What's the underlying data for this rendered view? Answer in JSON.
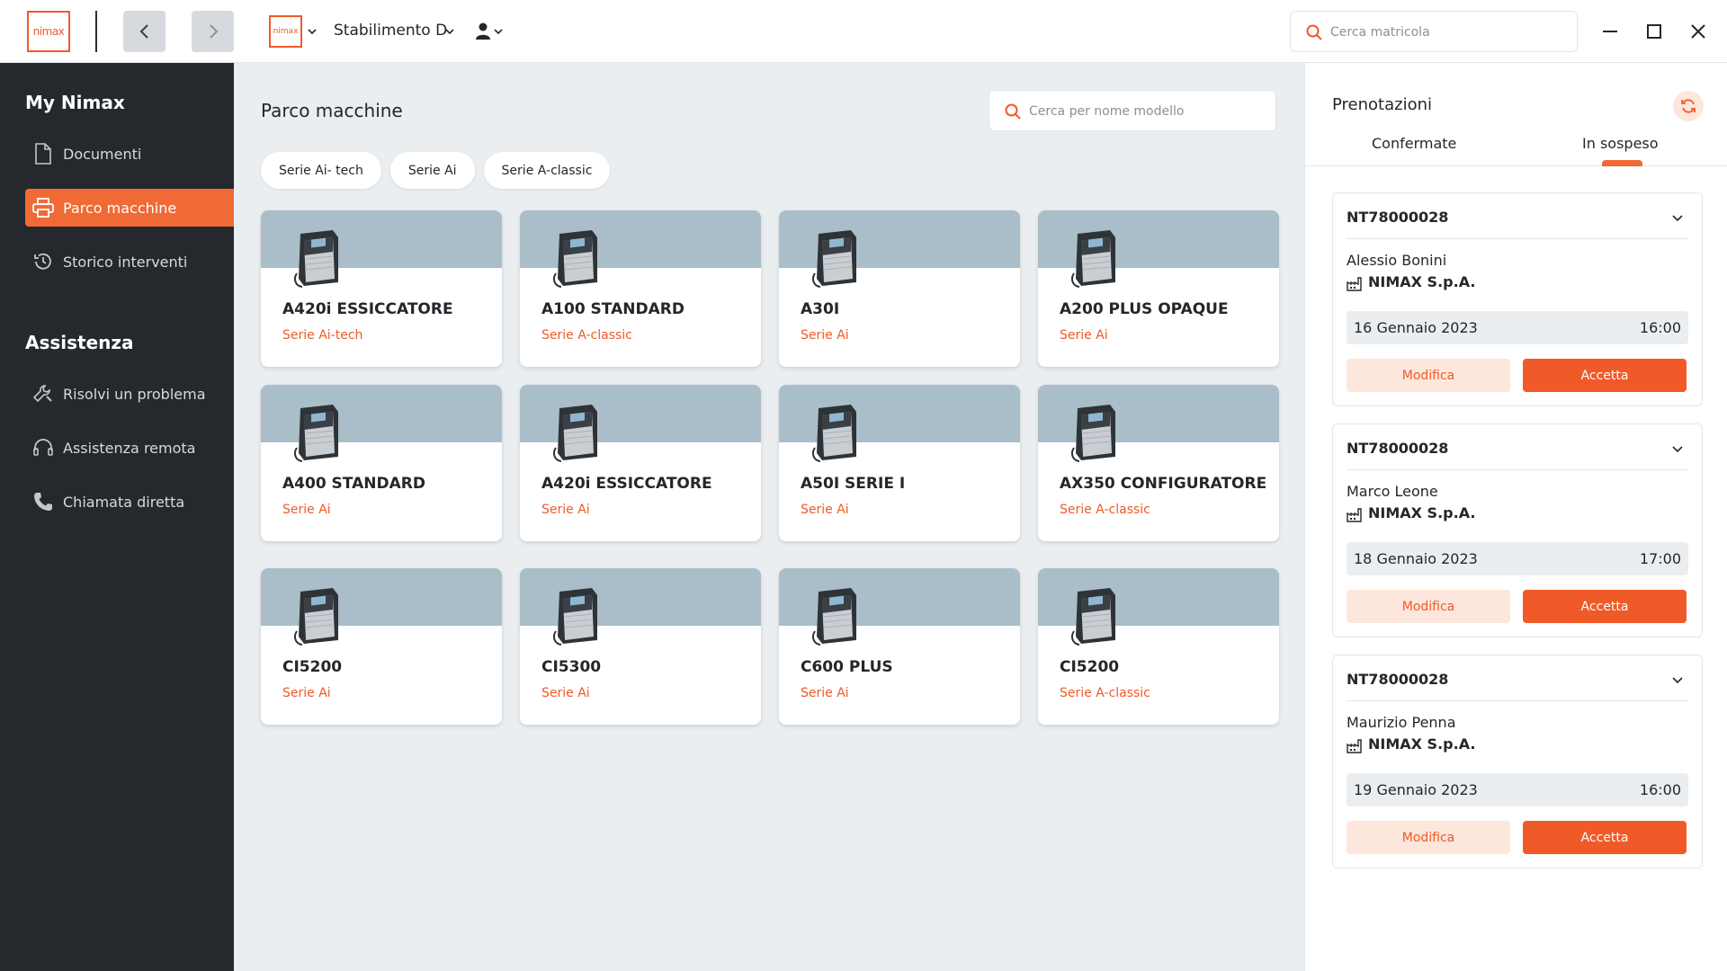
{
  "app": {
    "logo_text": "nimax"
  },
  "topbar": {
    "plant_logo_text": "nimax",
    "plant_name": "Stabilimento D",
    "search_placeholder": "Cerca matricola"
  },
  "sidebar": {
    "section1": "My Nimax",
    "items1": [
      {
        "label": "Documenti",
        "icon": "document-icon"
      },
      {
        "label": "Parco macchine",
        "icon": "printer-icon",
        "active": true
      },
      {
        "label": "Storico interventi",
        "icon": "history-icon"
      }
    ],
    "section2": "Assistenza",
    "items2": [
      {
        "label": "Risolvi un problema",
        "icon": "wrench-icon"
      },
      {
        "label": "Assistenza remota",
        "icon": "headset-icon"
      },
      {
        "label": "Chiamata diretta",
        "icon": "phone-icon"
      }
    ]
  },
  "main": {
    "title": "Parco macchine",
    "search_placeholder": "Cerca per nome modello",
    "filters": [
      "Serie Ai- tech",
      "Serie Ai",
      "Serie A-classic"
    ],
    "machines": [
      {
        "name": "A420i ESSICCATORE",
        "series": "Serie Ai-tech"
      },
      {
        "name": "A100 STANDARD",
        "series": "Serie A-classic"
      },
      {
        "name": "A30I",
        "series": "Serie Ai"
      },
      {
        "name": "A200 PLUS OPAQUE",
        "series": "Serie Ai"
      },
      {
        "name": "A400 STANDARD",
        "series": "Serie Ai"
      },
      {
        "name": "A420i ESSICCATORE",
        "series": "Serie Ai"
      },
      {
        "name": "A50I SERIE I",
        "series": "Serie Ai"
      },
      {
        "name": "AX350 CONFIGURATORE",
        "series": "Serie A-classic"
      },
      {
        "name": "CI5200",
        "series": "Serie Ai"
      },
      {
        "name": "CI5300",
        "series": "Serie Ai"
      },
      {
        "name": "C600 PLUS",
        "series": "Serie Ai"
      },
      {
        "name": "CI5200",
        "series": "Serie A-classic"
      }
    ]
  },
  "bookings": {
    "title": "Prenotazioni",
    "tabs": [
      "Confermate",
      "In sospeso"
    ],
    "active_tab": "In sospeso",
    "modify_label": "Modifica",
    "accept_label": "Accetta",
    "items": [
      {
        "code": "NT78000028",
        "person": "Alessio Bonini",
        "company": "NIMAX S.p.A.",
        "date": "16 Gennaio 2023",
        "time": "16:00"
      },
      {
        "code": "NT78000028",
        "person": "Marco Leone",
        "company": "NIMAX S.p.A.",
        "date": "18 Gennaio 2023",
        "time": "17:00"
      },
      {
        "code": "NT78000028",
        "person": "Maurizio Penna",
        "company": "NIMAX S.p.A.",
        "date": "19 Gennaio 2023",
        "time": "16:00"
      }
    ]
  },
  "colors": {
    "accent": "#f05a28",
    "sidebar_bg": "#25292d",
    "card_band": "#a9bec8",
    "main_bg": "#eaeef1"
  }
}
